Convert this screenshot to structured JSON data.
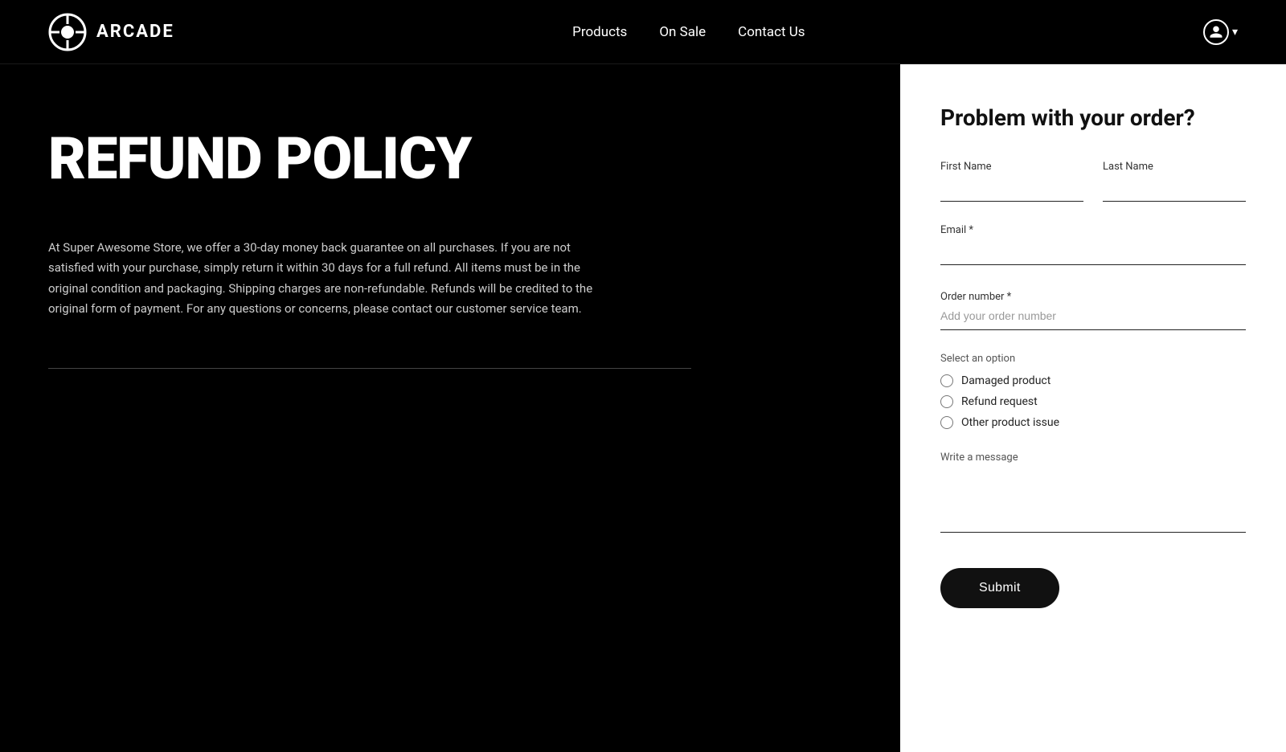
{
  "header": {
    "logo_text": "ARCADE",
    "nav": {
      "items": [
        {
          "label": "Products",
          "id": "products"
        },
        {
          "label": "On Sale",
          "id": "on-sale"
        },
        {
          "label": "Contact Us",
          "id": "contact-us"
        }
      ]
    },
    "user_chevron": "▾"
  },
  "page": {
    "title": "REFUND POLICY",
    "policy_text": "At Super Awesome Store, we offer a 30-day money back guarantee on all purchases. If you are not satisfied with your purchase, simply return it within 30 days for a full refund. All items must be in the original condition and packaging. Shipping charges are non-refundable. Refunds will be credited to the original form of payment. For any questions or concerns, please contact our customer service team."
  },
  "form": {
    "title": "Problem with your order?",
    "fields": {
      "first_name_label": "First Name",
      "last_name_label": "Last Name",
      "email_label": "Email *",
      "order_number_label": "Order number *",
      "order_number_placeholder": "Add your order number",
      "select_label": "Select an option",
      "options": [
        {
          "label": "Damaged product",
          "value": "damaged"
        },
        {
          "label": "Refund request",
          "value": "refund"
        },
        {
          "label": "Other product issue",
          "value": "other"
        }
      ],
      "message_label": "Write a message"
    },
    "submit_label": "Submit"
  }
}
